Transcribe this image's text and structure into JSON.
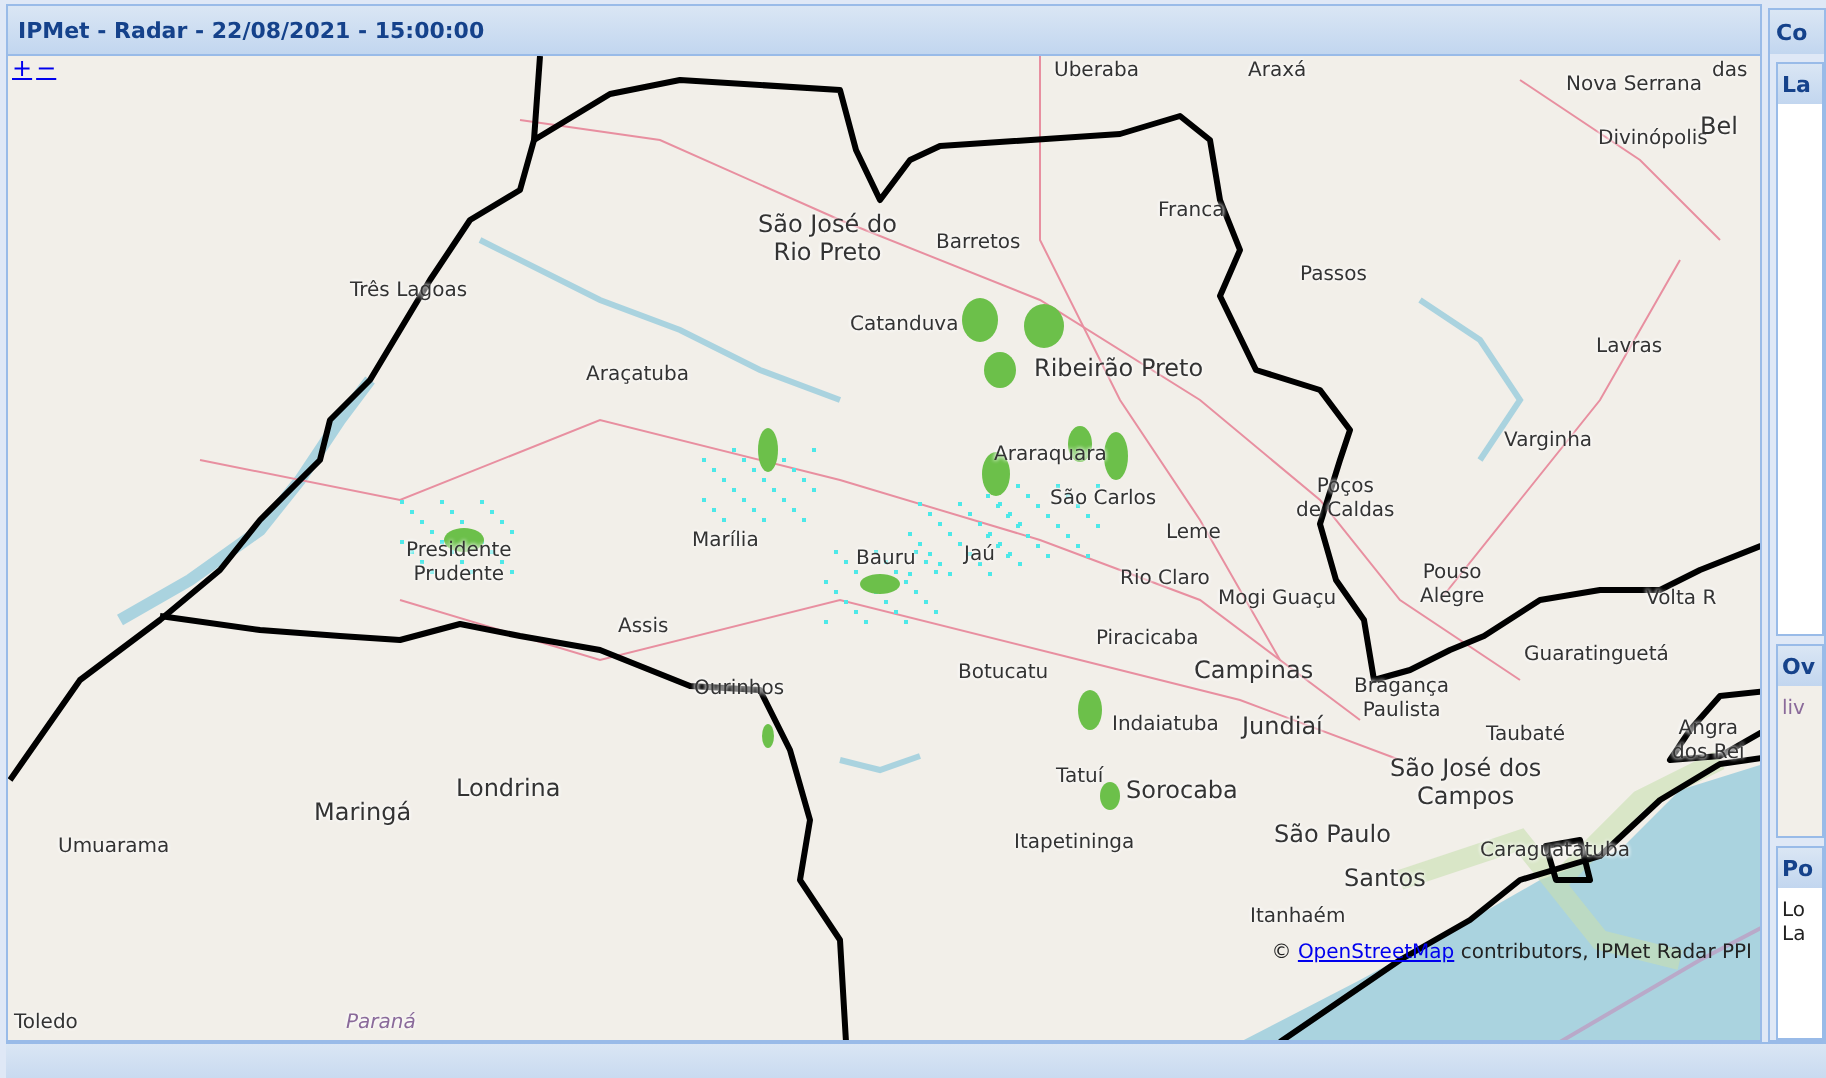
{
  "window": {
    "title": "IPMet - Radar - 22/08/2021 - 15:00:00"
  },
  "map": {
    "zoom_controls": [
      "+",
      "−"
    ],
    "labels": [
      {
        "text": "Uberaba",
        "kind": "city"
      },
      {
        "text": "Araxá",
        "kind": "city"
      },
      {
        "text": "Nova Serrana",
        "kind": "city"
      },
      {
        "text": "Divinópolis",
        "kind": "city"
      },
      {
        "text": "das",
        "kind": "city"
      },
      {
        "text": "Bel",
        "kind": "major"
      },
      {
        "text": "São José do\nRio Preto",
        "kind": "major"
      },
      {
        "text": "Barretos",
        "kind": "city"
      },
      {
        "text": "Franca",
        "kind": "city"
      },
      {
        "text": "Passos",
        "kind": "city"
      },
      {
        "text": "Três Lagoas",
        "kind": "city"
      },
      {
        "text": "Catanduva",
        "kind": "city"
      },
      {
        "text": "Ribeirão Preto",
        "kind": "major"
      },
      {
        "text": "Lavras",
        "kind": "city"
      },
      {
        "text": "Araçatuba",
        "kind": "city"
      },
      {
        "text": "Varginha",
        "kind": "city"
      },
      {
        "text": "Araraquara",
        "kind": "city"
      },
      {
        "text": "São Carlos",
        "kind": "city"
      },
      {
        "text": "Poços\nde Caldas",
        "kind": "city"
      },
      {
        "text": "Leme",
        "kind": "city"
      },
      {
        "text": "Marília",
        "kind": "city"
      },
      {
        "text": "Presidente\nPrudente",
        "kind": "city"
      },
      {
        "text": "Bauru",
        "kind": "city"
      },
      {
        "text": "Jaú",
        "kind": "city"
      },
      {
        "text": "Rio Claro",
        "kind": "city"
      },
      {
        "text": "Mogi Guaçu",
        "kind": "city"
      },
      {
        "text": "Pouso\nAlegre",
        "kind": "city"
      },
      {
        "text": "Volta R",
        "kind": "city"
      },
      {
        "text": "Assis",
        "kind": "city"
      },
      {
        "text": "Piracicaba",
        "kind": "city"
      },
      {
        "text": "Campinas",
        "kind": "major"
      },
      {
        "text": "Guaratinguetá",
        "kind": "city"
      },
      {
        "text": "Botucatu",
        "kind": "city"
      },
      {
        "text": "Ourinhos",
        "kind": "city"
      },
      {
        "text": "Bragança\nPaulista",
        "kind": "city"
      },
      {
        "text": "Indaiatuba",
        "kind": "city"
      },
      {
        "text": "Jundiaí",
        "kind": "major"
      },
      {
        "text": "Taubaté",
        "kind": "city"
      },
      {
        "text": "Angra\ndos Rei",
        "kind": "city"
      },
      {
        "text": "São José dos\nCampos",
        "kind": "major"
      },
      {
        "text": "Maringá",
        "kind": "major"
      },
      {
        "text": "Londrina",
        "kind": "major"
      },
      {
        "text": "Tatuí",
        "kind": "city"
      },
      {
        "text": "Sorocaba",
        "kind": "major"
      },
      {
        "text": "Umuarama",
        "kind": "city"
      },
      {
        "text": "Itapetininga",
        "kind": "city"
      },
      {
        "text": "São Paulo",
        "kind": "major"
      },
      {
        "text": "Caraguatatuba",
        "kind": "city"
      },
      {
        "text": "Santos",
        "kind": "major"
      },
      {
        "text": "Itanhaém",
        "kind": "city"
      },
      {
        "text": "Toledo",
        "kind": "city"
      },
      {
        "text": "Paraná",
        "kind": "region"
      }
    ],
    "attribution": {
      "prefix": "©",
      "link": "OpenStreetMap",
      "text": "contributors, IPMet Radar PPI"
    }
  },
  "side_panel": {
    "title": "Co",
    "sections": [
      {
        "title": "La"
      },
      {
        "title": "Ov",
        "lines": [
          "liv"
        ]
      },
      {
        "title": "Po",
        "lines": [
          "Lo",
          "La"
        ]
      }
    ]
  }
}
